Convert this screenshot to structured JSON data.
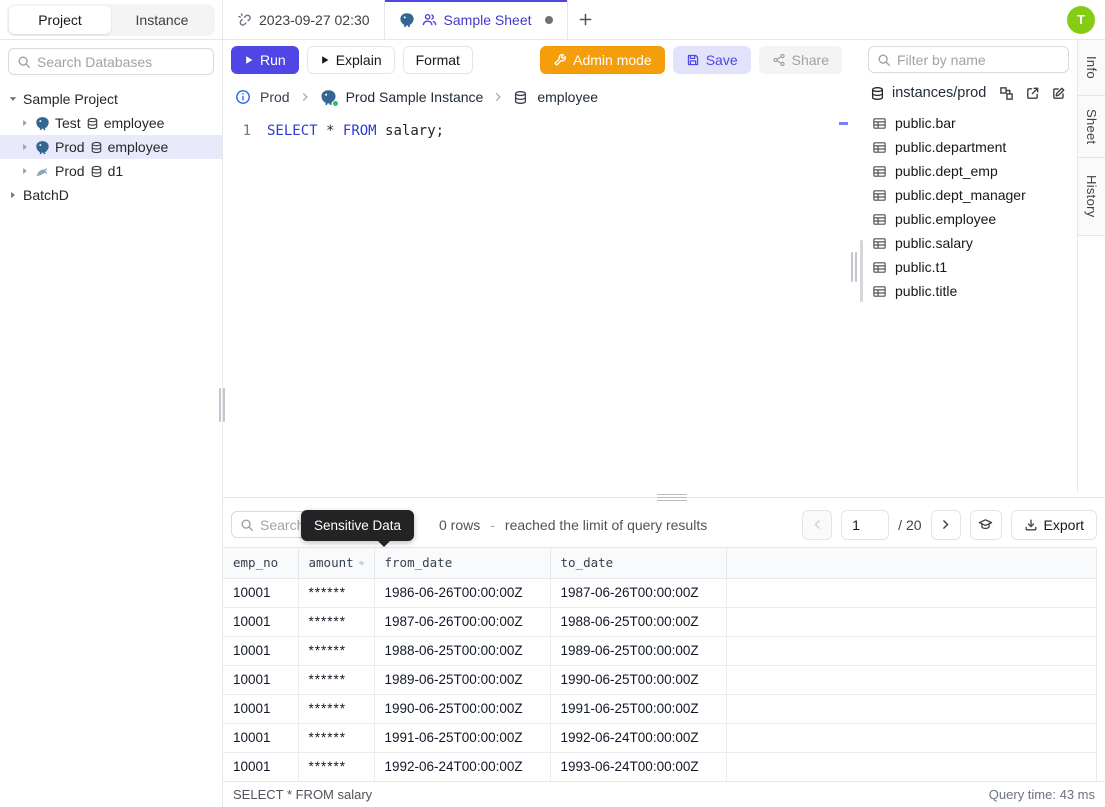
{
  "colors": {
    "accent": "#4f46e5",
    "admin_mode": "#f59e0b",
    "avatar": "#84cc16",
    "selected_row": "#e8eafc",
    "tooltip_bg": "#232326",
    "sql_keyword": "#2b3cd5",
    "postgres_blue": "#336791",
    "status_green": "#22c55e"
  },
  "header": {
    "project_tab": "Project",
    "instance_tab": "Instance",
    "tab1_label": "2023-09-27 02:30",
    "tab2_label": "Sample Sheet",
    "new_tab": "+",
    "avatar_initial": "T"
  },
  "sidebar": {
    "search_placeholder": "Search Databases",
    "tree": {
      "project": "Sample Project",
      "items": [
        {
          "env": "Test",
          "db": "employee"
        },
        {
          "env": "Prod",
          "db": "employee"
        },
        {
          "env": "Prod",
          "db": "d1"
        }
      ],
      "collapsed_project": "BatchD"
    }
  },
  "toolbar": {
    "run": "Run",
    "explain": "Explain",
    "format": "Format",
    "admin_mode": "Admin mode",
    "save": "Save",
    "share": "Share"
  },
  "breadcrumb": {
    "env": "Prod",
    "instance": "Prod Sample Instance",
    "database": "employee"
  },
  "editor": {
    "line_number": "1",
    "sql": {
      "kw1": "SELECT",
      "star": "*",
      "kw2": "FROM",
      "rest": "salary;"
    }
  },
  "right_panel": {
    "filter_placeholder": "Filter by name",
    "connection": "instances/prod",
    "tables": [
      "public.bar",
      "public.department",
      "public.dept_emp",
      "public.dept_manager",
      "public.employee",
      "public.salary",
      "public.t1",
      "public.title"
    ]
  },
  "side_tabs": {
    "info": "Info",
    "sheet": "Sheet",
    "history": "History"
  },
  "results": {
    "search_placeholder": "Search",
    "tooltip": "Sensitive Data",
    "row_count": "0 rows",
    "dash": "-",
    "limit_note": "reached the limit of query results",
    "page_value": "1",
    "page_total": "/ 20",
    "export": "Export",
    "table": {
      "headers": [
        "emp_no",
        "amount",
        "from_date",
        "to_date"
      ],
      "rows": [
        [
          "10001",
          "******",
          "1986-06-26T00:00:00Z",
          "1987-06-26T00:00:00Z"
        ],
        [
          "10001",
          "******",
          "1987-06-26T00:00:00Z",
          "1988-06-25T00:00:00Z"
        ],
        [
          "10001",
          "******",
          "1988-06-25T00:00:00Z",
          "1989-06-25T00:00:00Z"
        ],
        [
          "10001",
          "******",
          "1989-06-25T00:00:00Z",
          "1990-06-25T00:00:00Z"
        ],
        [
          "10001",
          "******",
          "1990-06-25T00:00:00Z",
          "1991-06-25T00:00:00Z"
        ],
        [
          "10001",
          "******",
          "1991-06-25T00:00:00Z",
          "1992-06-24T00:00:00Z"
        ],
        [
          "10001",
          "******",
          "1992-06-24T00:00:00Z",
          "1993-06-24T00:00:00Z"
        ]
      ]
    },
    "status_query": "SELECT * FROM salary",
    "query_time": "Query time: 43 ms"
  }
}
